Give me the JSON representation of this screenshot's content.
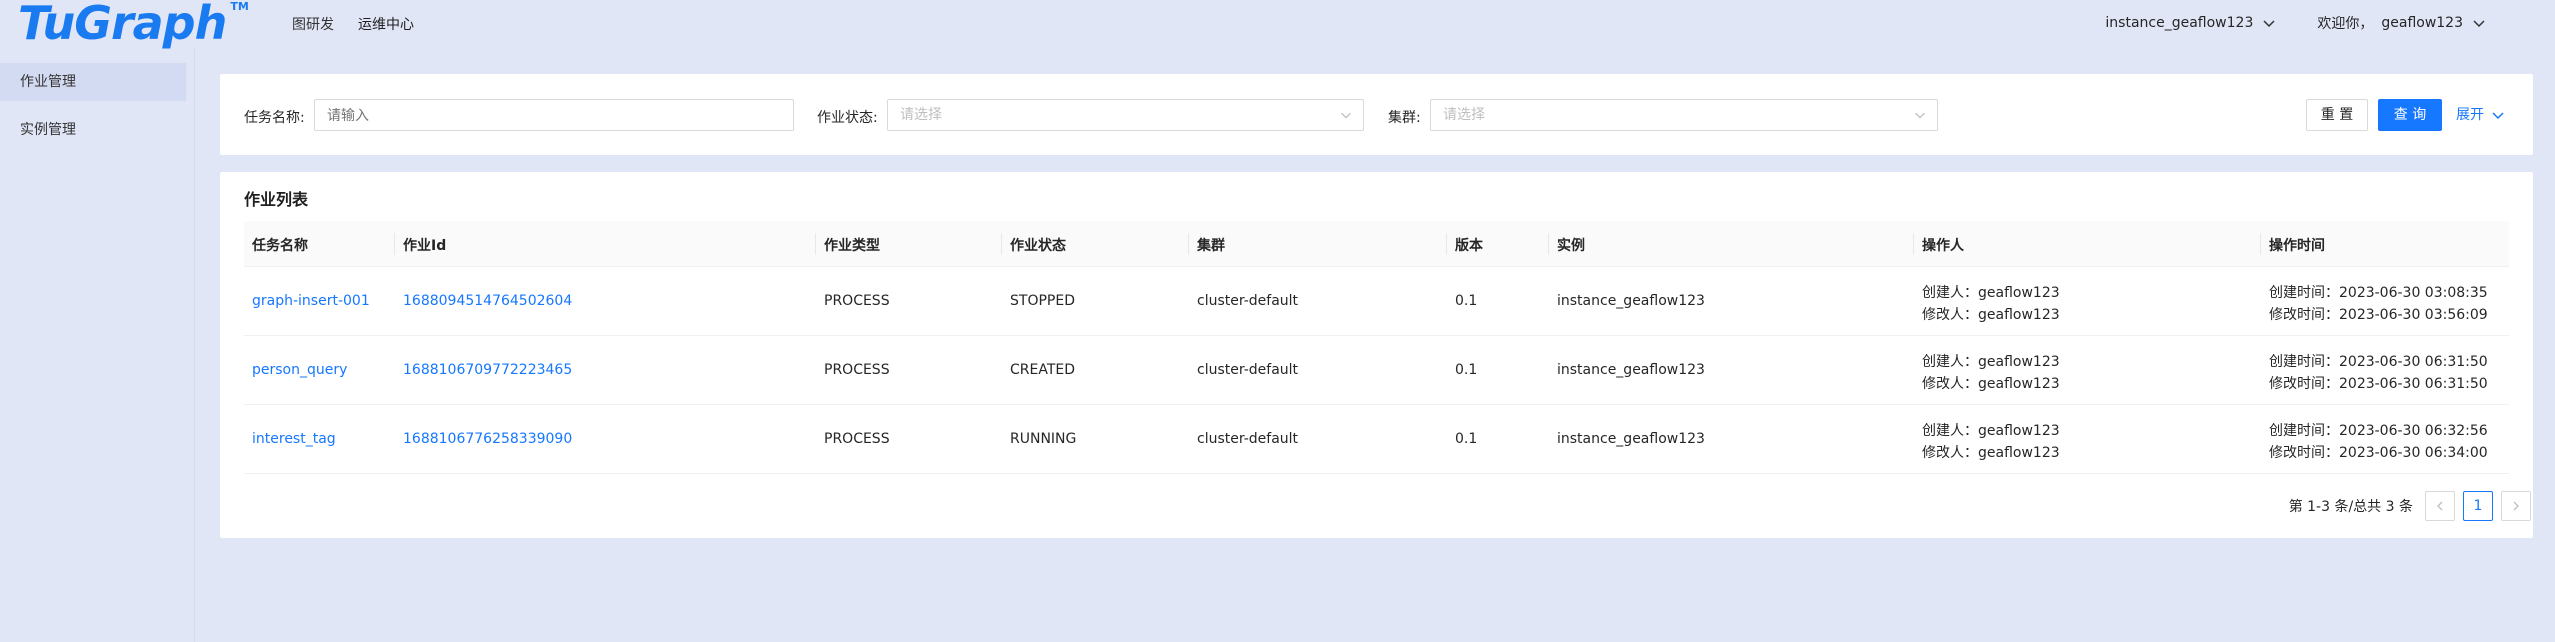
{
  "header": {
    "logo": "TuGraph",
    "logo_tm": "TM",
    "nav": [
      "图研发",
      "运维中心"
    ],
    "instance": "instance_geaflow123",
    "welcome": "欢迎你，",
    "user": "geaflow123"
  },
  "sidebar": {
    "items": [
      {
        "label": "作业管理",
        "active": true
      },
      {
        "label": "实例管理",
        "active": false
      }
    ]
  },
  "filter": {
    "task_name_label": "任务名称:",
    "task_name_placeholder": "请输入",
    "status_label": "作业状态:",
    "status_placeholder": "请选择",
    "cluster_label": "集群:",
    "cluster_placeholder": "请选择",
    "reset": "重 置",
    "search": "查 询",
    "expand": "展开"
  },
  "list": {
    "title": "作业列表",
    "columns": [
      "任务名称",
      "作业Id",
      "作业类型",
      "作业状态",
      "集群",
      "版本",
      "实例",
      "操作人",
      "操作时间"
    ],
    "rows": [
      {
        "name": "graph-insert-001",
        "id": "1688094514764502604",
        "type": "PROCESS",
        "status": "STOPPED",
        "cluster": "cluster-default",
        "version": "0.1",
        "instance": "instance_geaflow123",
        "creator": "创建人：geaflow123",
        "modifier": "修改人：geaflow123",
        "created": "创建时间：2023-06-30 03:08:35",
        "modified": "修改时间：2023-06-30 03:56:09"
      },
      {
        "name": "person_query",
        "id": "1688106709772223465",
        "type": "PROCESS",
        "status": "CREATED",
        "cluster": "cluster-default",
        "version": "0.1",
        "instance": "instance_geaflow123",
        "creator": "创建人：geaflow123",
        "modifier": "修改人：geaflow123",
        "created": "创建时间：2023-06-30 06:31:50",
        "modified": "修改时间：2023-06-30 06:31:50"
      },
      {
        "name": "interest_tag",
        "id": "1688106776258339090",
        "type": "PROCESS",
        "status": "RUNNING",
        "cluster": "cluster-default",
        "version": "0.1",
        "instance": "instance_geaflow123",
        "creator": "创建人：geaflow123",
        "modifier": "修改人：geaflow123",
        "created": "创建时间：2023-06-30 06:32:56",
        "modified": "修改时间：2023-06-30 06:34:00"
      }
    ]
  },
  "pagination": {
    "total": "第 1-3 条/总共 3 条",
    "current": "1"
  },
  "colors": {
    "primary": "#1677ff",
    "background": "#e1e6f7",
    "sidebar_active": "#d3dbf2"
  }
}
